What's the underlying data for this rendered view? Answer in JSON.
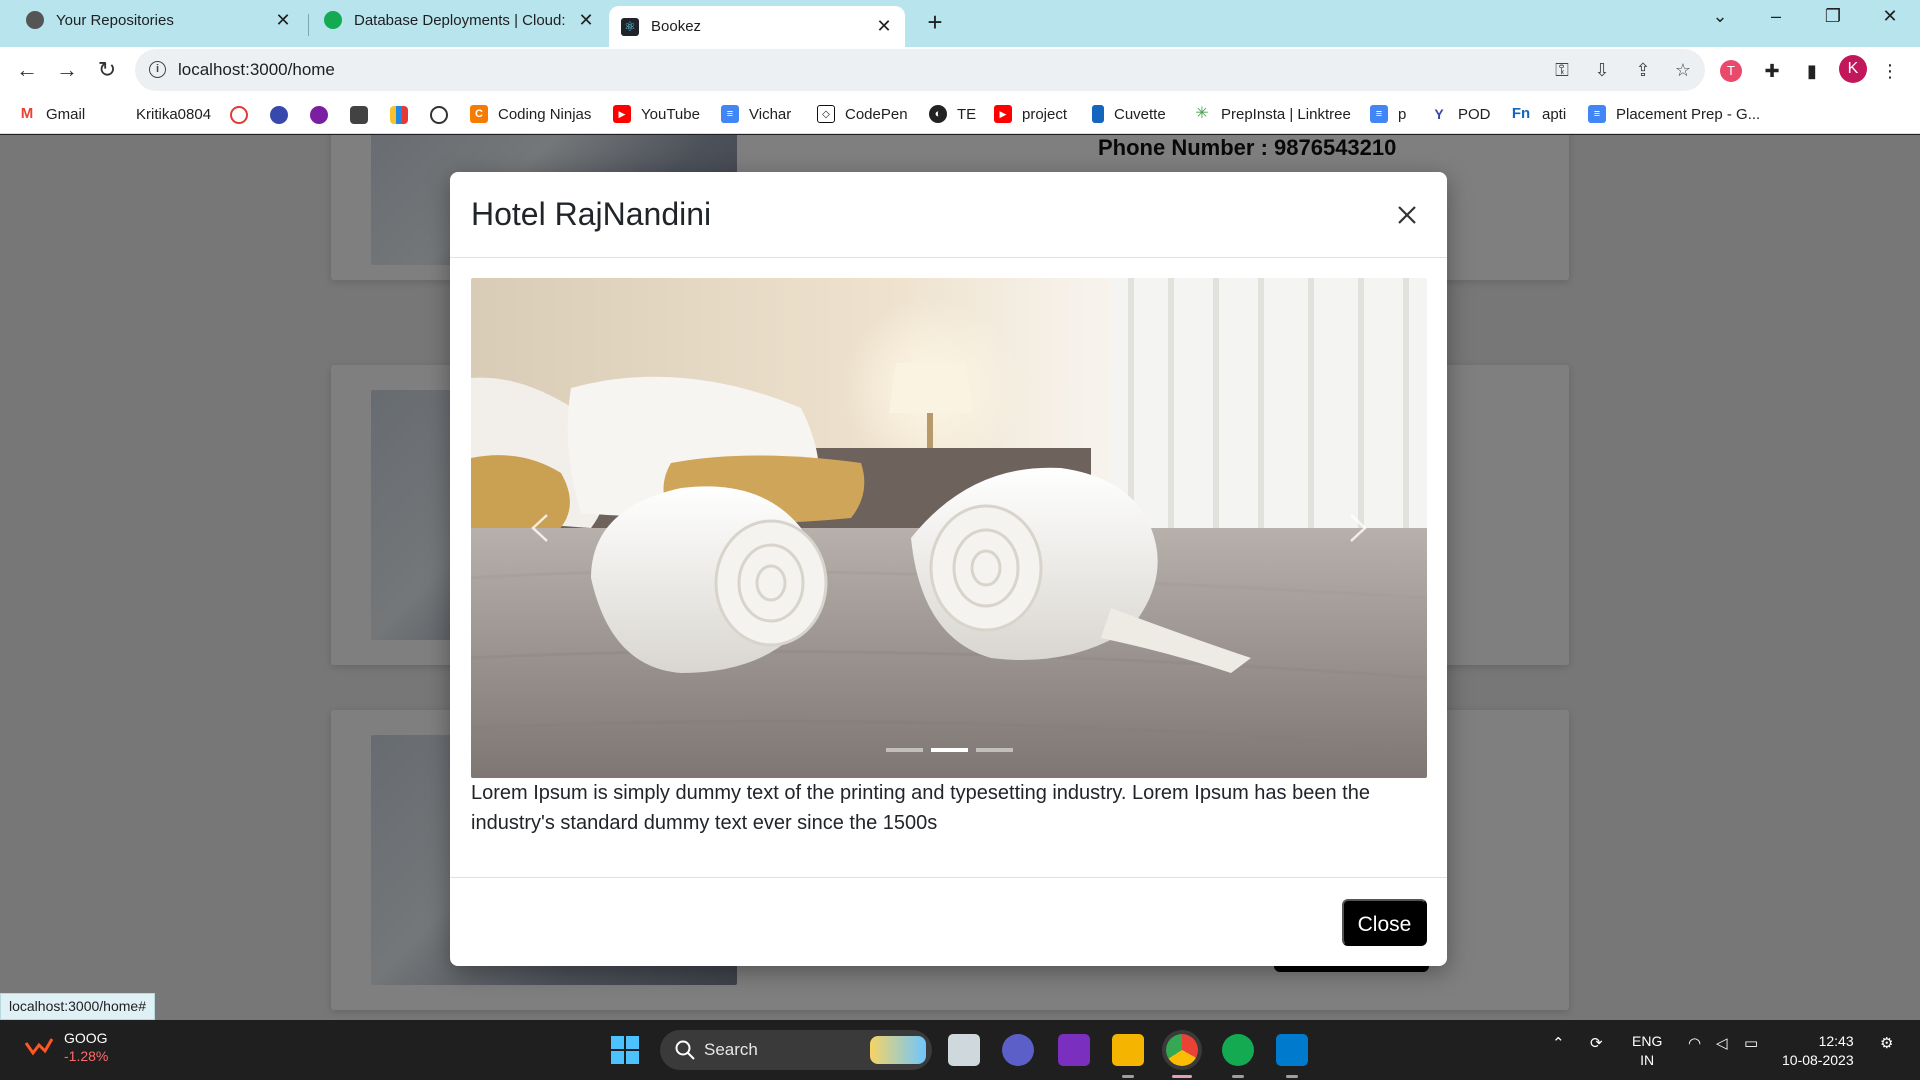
{
  "browser": {
    "tabs": [
      {
        "title": "Your Repositories",
        "active": false,
        "icon": "github-icon"
      },
      {
        "title": "Database Deployments | Cloud: M",
        "active": false,
        "icon": "mongodb-leaf-icon"
      },
      {
        "title": "Bookez",
        "active": true,
        "icon": "react-icon"
      }
    ],
    "url": "localhost:3000/home",
    "profile_initial": "K"
  },
  "bookmarks": [
    {
      "label": "Gmail",
      "icon": "gmail-icon"
    },
    {
      "label": "Kritika0804",
      "icon": "github-icon"
    },
    {
      "label": "Coding Ninjas",
      "icon": "coding-ninjas-icon"
    },
    {
      "label": "YouTube",
      "icon": "youtube-icon"
    },
    {
      "label": "Vichar",
      "icon": "docs-icon"
    },
    {
      "label": "CodePen",
      "icon": "codepen-icon"
    },
    {
      "label": "TE",
      "icon": "globe-icon"
    },
    {
      "label": "project",
      "icon": "youtube-icon"
    },
    {
      "label": "Cuvette",
      "icon": "cuvette-icon"
    },
    {
      "label": "PrepInsta | Linktree",
      "icon": "linktree-icon"
    },
    {
      "label": "p",
      "icon": "docs-icon"
    },
    {
      "label": "POD",
      "icon": "pod-icon"
    },
    {
      "label": "apti",
      "icon": "fn-icon"
    },
    {
      "label": "Placement Prep - G...",
      "icon": "docs-icon"
    }
  ],
  "background_page": {
    "phone_text": "Phone Number : 9876543210"
  },
  "modal": {
    "title": "Hotel RajNandini",
    "description": "Lorem Ipsum is simply dummy text of the printing and typesetting industry. Lorem Ipsum has been the industry's standard dummy text ever since the 1500s",
    "close_label": "Close",
    "carousel": {
      "slide_count": 3,
      "active_index": 1
    }
  },
  "status_bar_url": "localhost:3000/home#",
  "taskbar": {
    "stock_name": "GOOG",
    "stock_change": "-1.28%",
    "search_label": "Search",
    "lang_line1": "ENG",
    "lang_line2": "IN",
    "time": "12:43",
    "date": "10-08-2023"
  },
  "colors": {
    "accent_tabstrip": "#b8e4ee",
    "modal_button": "#000000",
    "stock_negative": "#ff6b6b",
    "profile_avatar": "#c2185b"
  }
}
